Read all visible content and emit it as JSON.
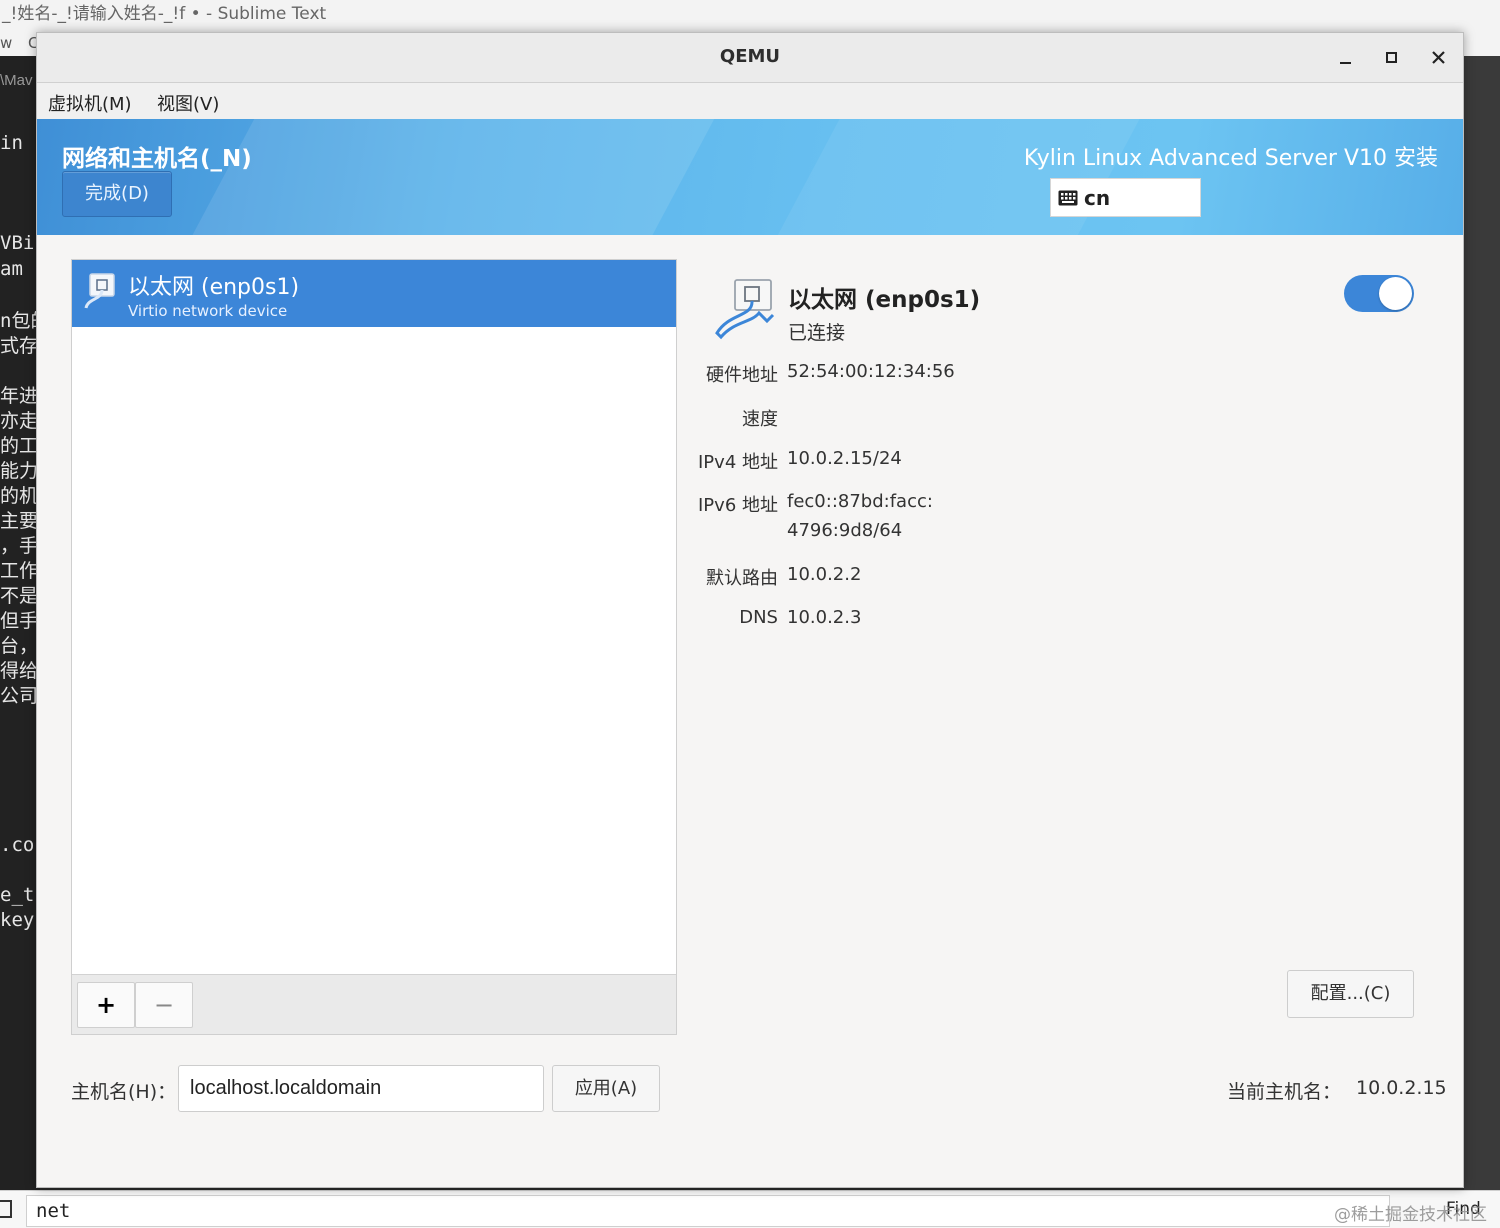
{
  "background": {
    "window_title": "_!姓名-_!请输入姓名-_!f • - Sublime Text",
    "row2_fragments": [
      "w",
      "C"
    ],
    "left_edge_fragments": [
      "\\Mav",
      "in",
      "VBi",
      "am",
      "n包的",
      "式存",
      "年进",
      "亦走",
      "的工",
      "能力",
      "的机",
      "主要",
      "，手",
      "工作",
      "不是",
      "但手",
      "台，",
      "得给",
      "公司",
      ".co",
      "e_t",
      "key"
    ],
    "find_text": "net",
    "find_button": "Find",
    "watermark": "@稀土掘金技术社区"
  },
  "qemu": {
    "title": "QEMU",
    "minimize": "_",
    "maximize": "□",
    "close": "✕",
    "menu": [
      "虚拟机(M)",
      "视图(V)"
    ]
  },
  "header": {
    "section_title": "网络和主机名(_N)",
    "done_button": "完成(D)",
    "product_title": "Kylin Linux Advanced Server V10 安装",
    "keyboard_layout": "cn",
    "keyboard_icon": "keyboard-icon"
  },
  "device_list": {
    "items": [
      {
        "name": "以太网 (enp0s1)",
        "description": "Virtio network device",
        "icon": "ethernet-icon"
      }
    ],
    "add_label": "+",
    "remove_label": "−"
  },
  "details": {
    "name": "以太网 (enp0s1)",
    "status": "已连接",
    "enabled": true,
    "properties": [
      {
        "label": "硬件地址",
        "value": "52:54:00:12:34:56"
      },
      {
        "label": "速度",
        "value": ""
      },
      {
        "label": "IPv4 地址",
        "value": "10.0.2.15/24"
      },
      {
        "label": "IPv6 地址",
        "value": "fec0::87bd:facc:",
        "value2": "4796:9d8/64"
      },
      {
        "label": "默认路由",
        "value": "10.0.2.2"
      },
      {
        "label": "DNS",
        "value": "10.0.2.3"
      }
    ],
    "config_button": "配置...(C)"
  },
  "hostname": {
    "label": "主机名(H)：",
    "value": "localhost.localdomain",
    "apply_button": "应用(A)",
    "current_label": "当前主机名：",
    "current_value": "10.0.2.15"
  }
}
